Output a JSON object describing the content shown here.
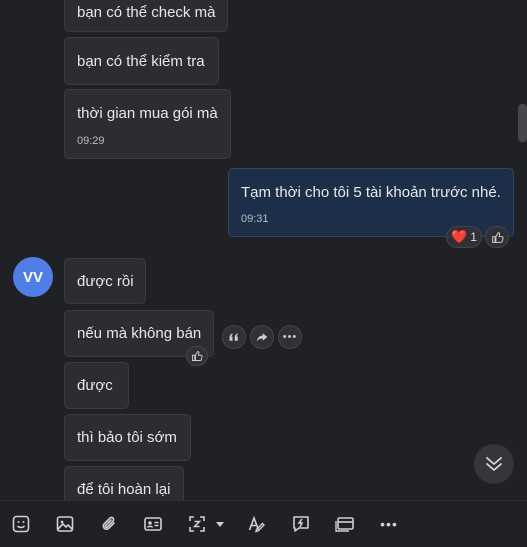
{
  "messages": {
    "m1": "bạn có thể check mà",
    "m2": "bạn có thể kiểm tra",
    "m3": "thời gian mua gói mà",
    "m3_time": "09:29",
    "mine": "Tạm thời cho tôi 5 tài khoản trước nhé.",
    "mine_time": "09:31",
    "m4": "được rồi",
    "m5": "nếu mà không bán",
    "m6": "được",
    "m7": "thì bảo tôi sớm",
    "m8": "để tôi hoàn lại"
  },
  "avatar": {
    "initials": "VV",
    "color": "#4f7fe6"
  },
  "reaction": {
    "emoji": "❤️",
    "count": "1"
  },
  "colors": {
    "background": "#202124",
    "bubble": "#2b2d31",
    "mine_bubble": "#1d2f48"
  }
}
